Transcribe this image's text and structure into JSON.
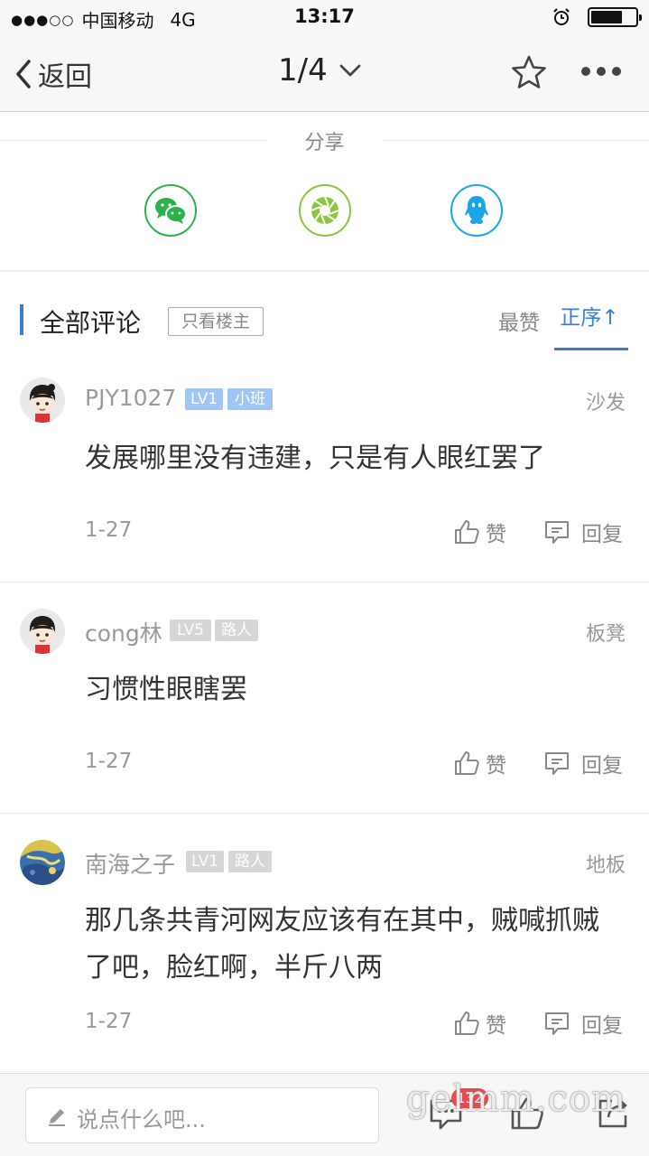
{
  "status_bar": {
    "signal": "●●●○○",
    "carrier": "中国移动",
    "network": "4G",
    "time": "13:17",
    "battery_level": 0.7
  },
  "nav": {
    "back_label": "返回",
    "page_indicator": "1/4",
    "icons": [
      "chevron-left-icon",
      "chevron-down-icon",
      "star-icon",
      "more-icon"
    ]
  },
  "share": {
    "title": "分享",
    "targets": [
      {
        "icon": "wechat-icon",
        "color": "#2bb24c"
      },
      {
        "icon": "moments-icon",
        "color": "#8cc63f"
      },
      {
        "icon": "qq-icon",
        "color": "#1aa5e8"
      }
    ]
  },
  "comments_header": {
    "title": "全部评论",
    "op_only_label": "只看楼主",
    "sort_hot_label": "最赞",
    "sort_order_label": "正序↑",
    "accent_color": "#3a7dd6"
  },
  "comments": [
    {
      "username": "PJY1027",
      "level": "LV1",
      "rank": "小班",
      "floor": "沙发",
      "text": "发展哪里没有违建，只是有人眼红罢了",
      "date": "1-27",
      "like_label": "赞",
      "reply_label": "回复"
    },
    {
      "username": "cong林",
      "level": "LV5",
      "rank": "路人",
      "floor": "板凳",
      "text": "习惯性眼瞎罢",
      "date": "1-27",
      "like_label": "赞",
      "reply_label": "回复"
    },
    {
      "username": "南海之子",
      "level": "LV1",
      "rank": "路人",
      "floor": "地板",
      "text": "那几条共青河网友应该有在其中，贼喊抓贼了吧，脸红啊，半斤八两",
      "date": "1-27",
      "like_label": "赞",
      "reply_label": "回复"
    }
  ],
  "bottom_bar": {
    "input_placeholder": "说点什么吧...",
    "comment_count": "132",
    "watermark": "gelmm.com"
  }
}
